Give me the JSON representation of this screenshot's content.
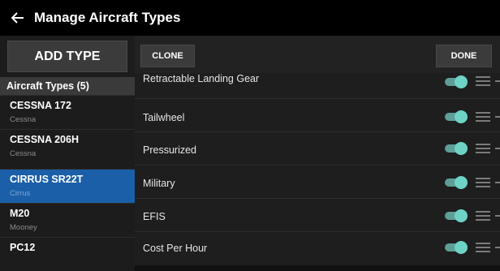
{
  "header": {
    "title": "Manage Aircraft Types",
    "back_icon": "arrow-left-icon"
  },
  "left_panel": {
    "add_button_label": "ADD TYPE",
    "list_header": "Aircraft Types (5)",
    "types": [
      {
        "name": "CESSNA 172",
        "manufacturer": "Cessna",
        "selected": false
      },
      {
        "name": "CESSNA 206H",
        "manufacturer": "Cessna",
        "selected": false
      },
      {
        "name": "CIRRUS SR22T",
        "manufacturer": "Cirrus",
        "selected": true
      },
      {
        "name": "M20",
        "manufacturer": "Mooney",
        "selected": false
      },
      {
        "name": "PC12",
        "manufacturer": "",
        "selected": false
      }
    ]
  },
  "right_panel": {
    "clone_label": "CLONE",
    "done_label": "DONE",
    "features": [
      {
        "label": "Retractable Landing Gear",
        "enabled": true
      },
      {
        "label": "Tailwheel",
        "enabled": true
      },
      {
        "label": "Pressurized",
        "enabled": true
      },
      {
        "label": "Military",
        "enabled": true
      },
      {
        "label": "EFIS",
        "enabled": true
      },
      {
        "label": "Cost Per Hour",
        "enabled": true
      }
    ]
  },
  "colors": {
    "selected": "#1b5fa8",
    "toggle_on": "#6ed3c6",
    "background": "#111111"
  }
}
